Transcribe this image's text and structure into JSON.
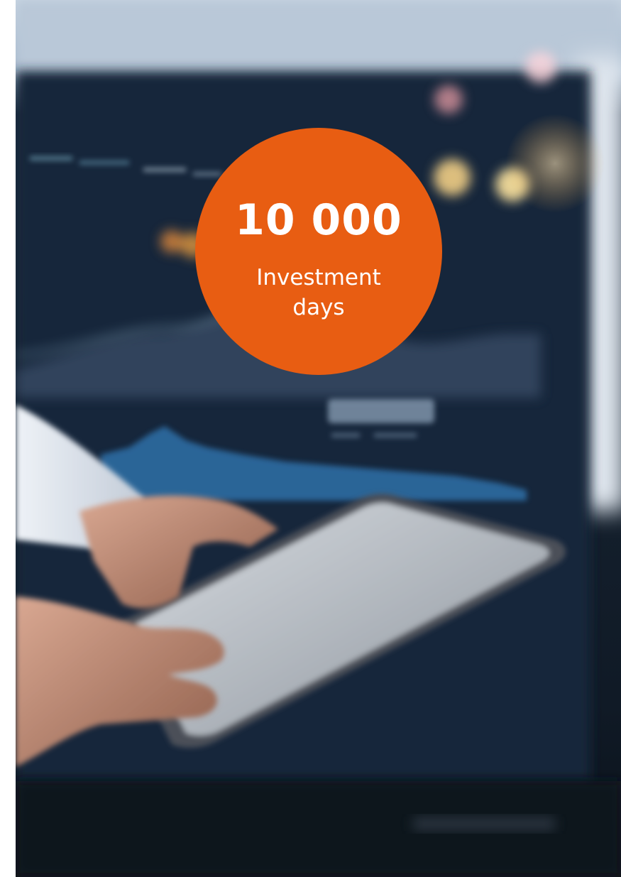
{
  "stat": {
    "value": "10 000",
    "label": "Investment\ndays"
  },
  "colors": {
    "badge": "#e85d12",
    "badge_text": "#ffffff",
    "screen_background": "#15212f"
  },
  "photo": {
    "subject": "blurred-hands-holding-tablet-in-front-of-financial-chart-monitor"
  }
}
